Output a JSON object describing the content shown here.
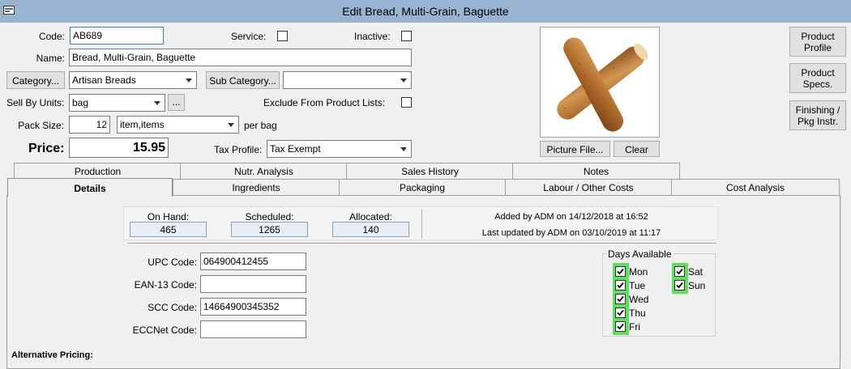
{
  "window": {
    "title": "Edit Bread, Multi-Grain, Baguette"
  },
  "form": {
    "code_label": "Code:",
    "code_value": "AB689",
    "service_label": "Service:",
    "inactive_label": "Inactive:",
    "name_label": "Name:",
    "name_value": "Bread, Multi-Grain, Baguette",
    "category_button": "Category...",
    "category_value": "Artisan Breads",
    "subcategory_button": "Sub Category...",
    "subcategory_value": "",
    "sell_by_units_label": "Sell By Units:",
    "sell_by_units_value": "bag",
    "ellipsis_button": "...",
    "exclude_label": "Exclude From Product Lists:",
    "pack_size_label": "Pack Size:",
    "pack_size_value": "12",
    "pack_unit_value": "item,items",
    "per_bag_label": "per bag",
    "price_label": "Price:",
    "price_value": "15.95",
    "tax_profile_label": "Tax Profile:",
    "tax_profile_value": "Tax Exempt"
  },
  "picture": {
    "picture_file_button": "Picture File...",
    "clear_button": "Clear"
  },
  "side_buttons": {
    "product_profile_1": "Product",
    "product_profile_2": "Profile",
    "product_specs_1": "Product",
    "product_specs_2": "Specs.",
    "finishing_1": "Finishing /",
    "finishing_2": "Pkg Instr."
  },
  "tabs_row1": [
    "Production",
    "Nutr. Analysis",
    "Sales History",
    "Notes"
  ],
  "tabs_row2": [
    "Details",
    "Ingredients",
    "Packaging",
    "Labour / Other Costs",
    "Cost Analysis"
  ],
  "details": {
    "on_hand_label": "On Hand:",
    "on_hand_value": "465",
    "scheduled_label": "Scheduled:",
    "scheduled_value": "1265",
    "allocated_label": "Allocated:",
    "allocated_value": "140",
    "added_by": "Added by ADM on 14/12/2018 at 16:52",
    "last_updated": "Last updated by ADM on 03/10/2019 at 11:17",
    "upc_label": "UPC Code:",
    "upc_value": "064900412455",
    "ean_label": "EAN-13 Code:",
    "ean_value": "",
    "scc_label": "SCC Code:",
    "scc_value": "14664900345352",
    "eccnet_label": "ECCNet Code:",
    "eccnet_value": "",
    "days_title": "Days Available",
    "days": [
      "Mon",
      "Tue",
      "Wed",
      "Thu",
      "Fri",
      "Sat",
      "Sun"
    ],
    "alt_pricing_label": "Alternative Pricing:"
  },
  "colors": {
    "titlebar": "#99b4d1",
    "day_checked_highlight": "#5ee05e"
  }
}
